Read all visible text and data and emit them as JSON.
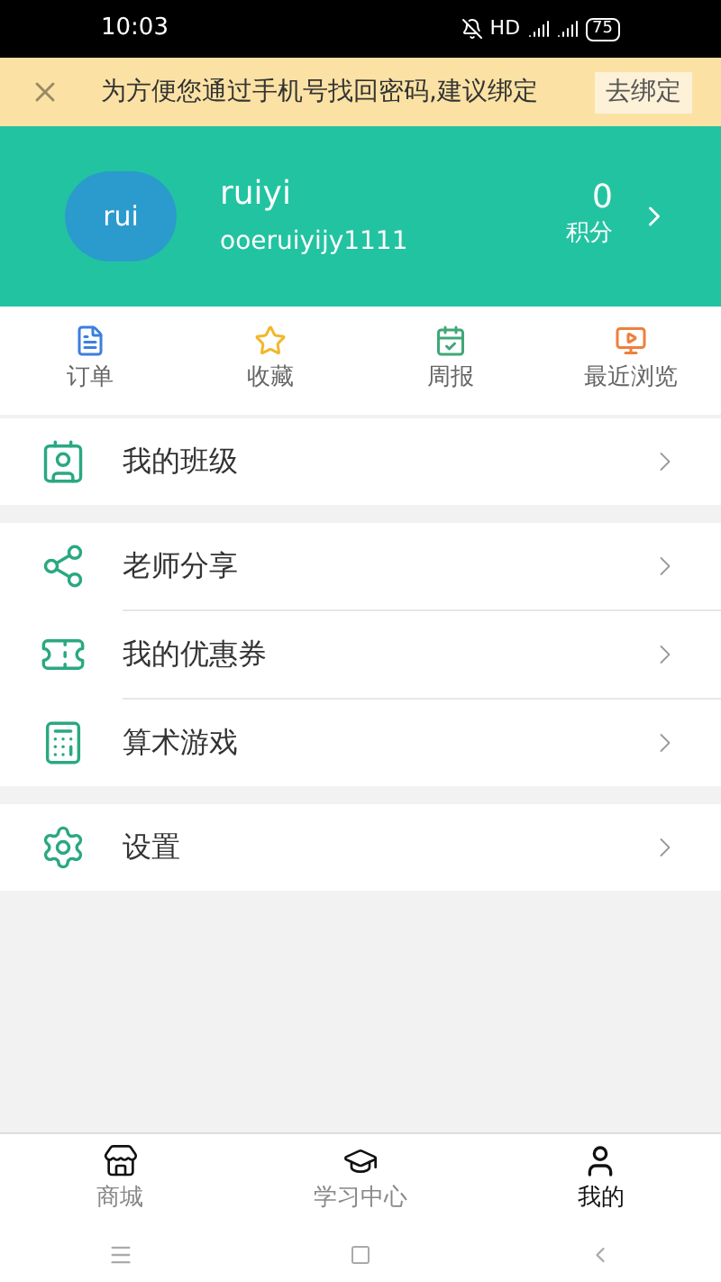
{
  "status_bar": {
    "time": "10:03",
    "network": "HD",
    "battery": "75"
  },
  "banner": {
    "message": "为方便您通过手机号找回密码,建议绑定",
    "action": "去绑定"
  },
  "profile": {
    "avatar": "rui",
    "name": "ruiyi",
    "account": "ooeruiyijy1111",
    "points": "0",
    "points_label": "积分"
  },
  "shortcuts": [
    {
      "label": "订单",
      "kind": "orders"
    },
    {
      "label": "收藏",
      "kind": "favorites"
    },
    {
      "label": "周报",
      "kind": "weekly"
    },
    {
      "label": "最近浏览",
      "kind": "recent"
    }
  ],
  "menu_groups": [
    [
      {
        "label": "我的班级",
        "kind": "class"
      }
    ],
    [
      {
        "label": "老师分享",
        "kind": "share"
      },
      {
        "label": "我的优惠券",
        "kind": "coupon"
      },
      {
        "label": "算术游戏",
        "kind": "math"
      }
    ],
    [
      {
        "label": "设置",
        "kind": "settings"
      }
    ]
  ],
  "tab_bar": [
    {
      "label": "商城",
      "kind": "shop",
      "selected": false
    },
    {
      "label": "学习中心",
      "kind": "study",
      "selected": false
    },
    {
      "label": "我的",
      "kind": "me",
      "selected": true
    }
  ]
}
